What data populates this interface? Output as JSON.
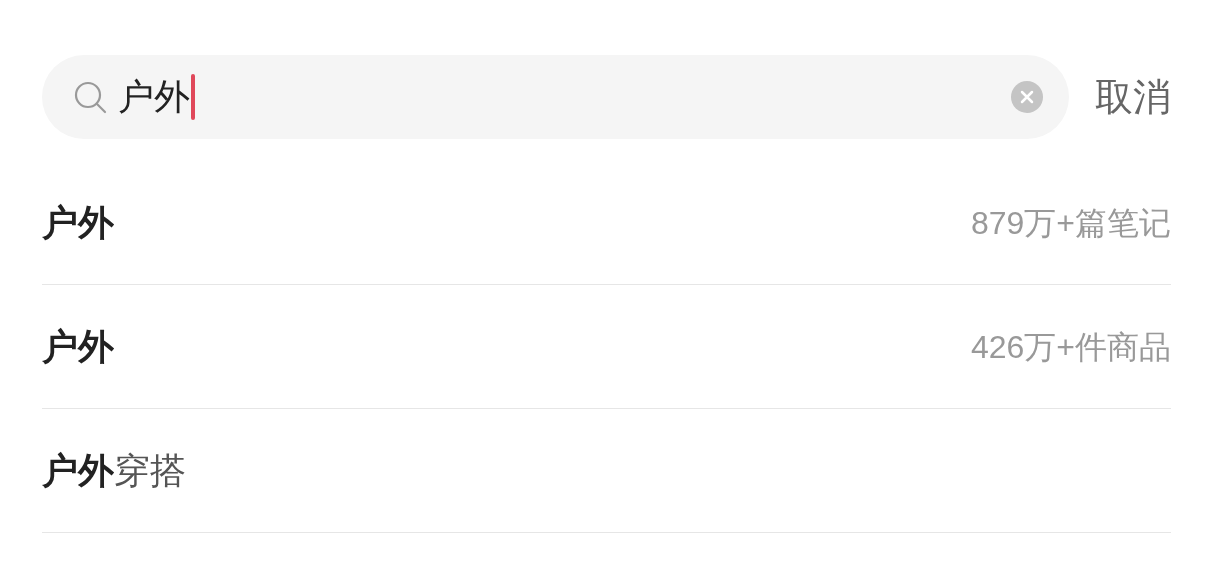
{
  "search": {
    "value": "户外"
  },
  "cancel": "取消",
  "suggestions": [
    {
      "text": "户外",
      "count": "879万+篇笔记"
    },
    {
      "text": "户外",
      "count": "426万+件商品"
    },
    {
      "text": "**户外**穿搭"
    }
  ]
}
